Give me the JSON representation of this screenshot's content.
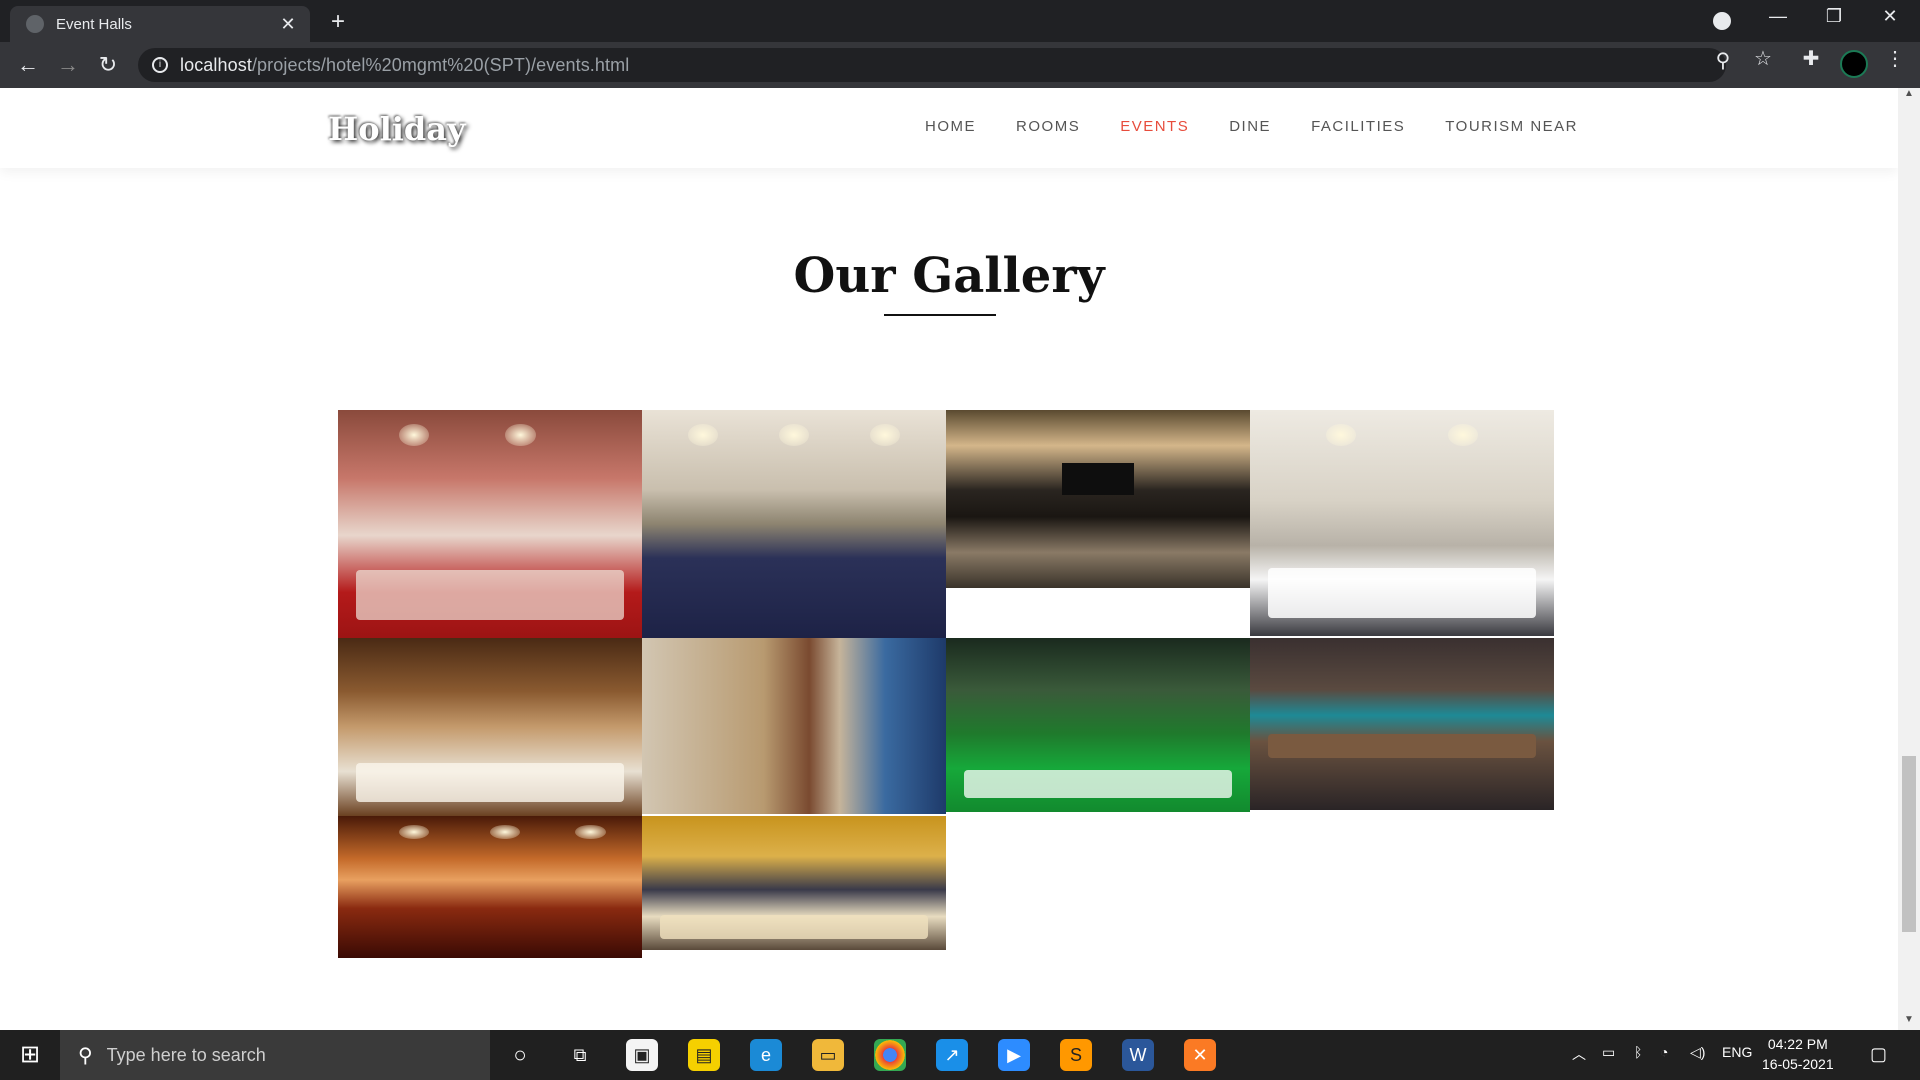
{
  "browser": {
    "tab_title": "Event Halls",
    "url_host": "localhost",
    "url_path": "/projects/hotel%20mgmt%20(SPT)/events.html"
  },
  "site": {
    "logo": "Holiday",
    "nav": [
      {
        "label": "HOME"
      },
      {
        "label": "ROOMS"
      },
      {
        "label": "EVENTS",
        "active": true
      },
      {
        "label": "DINE"
      },
      {
        "label": "FACILITIES"
      },
      {
        "label": "TOURISM NEAR"
      }
    ],
    "gallery_title": "Our Gallery",
    "accent_color": "#e74c3c",
    "gallery": [
      {
        "name": "red-ballroom-photo"
      },
      {
        "name": "blue-chairs-hall-photo"
      },
      {
        "name": "conference-stage-photo"
      },
      {
        "name": "white-banquet-photo"
      },
      {
        "name": "wooden-banquet-photo"
      },
      {
        "name": "lecture-room-photo"
      },
      {
        "name": "garden-event-photo"
      },
      {
        "name": "long-table-photo"
      },
      {
        "name": "grand-auditorium-photo"
      },
      {
        "name": "boardroom-photo"
      }
    ]
  },
  "taskbar": {
    "search_placeholder": "Type here to search",
    "lang": "ENG",
    "time": "04:22 PM",
    "date": "16-05-2021"
  }
}
